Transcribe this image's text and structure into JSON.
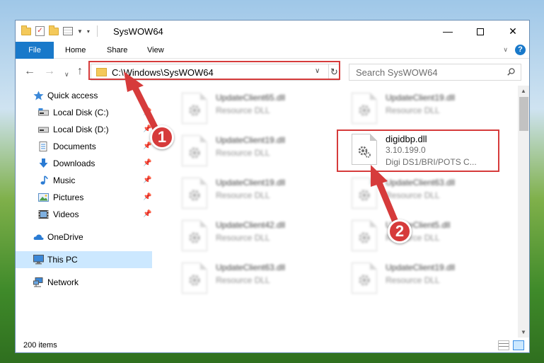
{
  "window": {
    "title": "SysWOW64",
    "controls": {
      "minimize": "—",
      "maximize": "",
      "close": "✕"
    }
  },
  "ribbon": {
    "file_label": "File",
    "tabs": [
      "Home",
      "Share",
      "View"
    ]
  },
  "navigation": {
    "address": "C:\\Windows\\SysWOW64",
    "search_placeholder": "Search SysWOW64"
  },
  "sidebar": {
    "items": [
      {
        "label": "Quick access",
        "icon": "star-icon"
      },
      {
        "label": "Local Disk (C:)",
        "icon": "drive-icon",
        "pinned": true
      },
      {
        "label": "Local Disk (D:)",
        "icon": "drive-icon",
        "pinned": true
      },
      {
        "label": "Documents",
        "icon": "documents-icon",
        "pinned": true
      },
      {
        "label": "Downloads",
        "icon": "download-icon",
        "pinned": true
      },
      {
        "label": "Music",
        "icon": "music-icon",
        "pinned": true
      },
      {
        "label": "Pictures",
        "icon": "pictures-icon",
        "pinned": true
      },
      {
        "label": "Videos",
        "icon": "video-icon",
        "pinned": true
      },
      {
        "label": "OneDrive",
        "icon": "cloud-icon"
      },
      {
        "label": "This PC",
        "icon": "computer-icon",
        "selected": true
      },
      {
        "label": "Network",
        "icon": "network-icon"
      }
    ]
  },
  "files": [
    {
      "name": "UpdateClient65.dll",
      "type": "Resource DLL"
    },
    {
      "name": "UpdateClient19.dll",
      "type": "Resource DLL"
    },
    {
      "name": "UpdateClient19.dll",
      "type": "Resource DLL"
    },
    {
      "name": "digidbp.dll",
      "version": "3.10.199.0",
      "description": "Digi DS1/BRI/POTS C...",
      "highlighted": true
    },
    {
      "name": "UpdateClient19.dll",
      "type": "Resource DLL"
    },
    {
      "name": "UpdateClient63.dll",
      "type": "Resource DLL"
    },
    {
      "name": "UpdateClient42.dll",
      "type": "Resource DLL"
    },
    {
      "name": "UpdateClient5.dll",
      "type": "Resource DLL"
    },
    {
      "name": "UpdateClient63.dll",
      "type": "Resource DLL"
    },
    {
      "name": "UpdateClient19.dll",
      "type": "Resource DLL"
    }
  ],
  "status": {
    "item_count": "200 items"
  },
  "callouts": [
    "1",
    "2"
  ],
  "colors": {
    "accent": "#1979ca",
    "highlight": "#d63b3b",
    "selection": "#cce8ff"
  }
}
